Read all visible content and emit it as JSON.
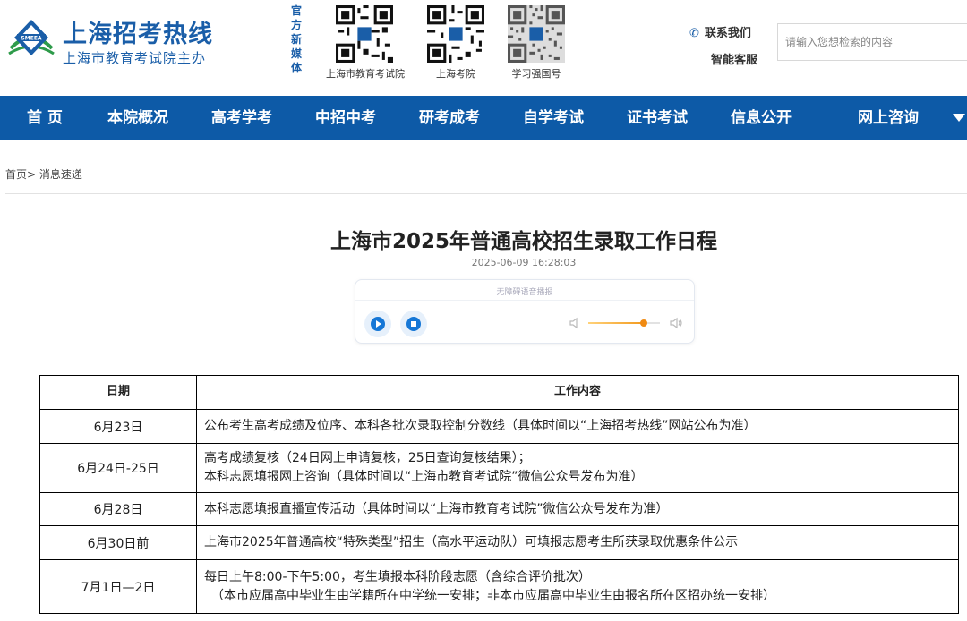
{
  "header": {
    "site_title": "上海招考热线",
    "site_subtitle": "上海市教育考试院主办",
    "logo_text": "SMEEA",
    "media_label": "官方新媒体",
    "qr_codes": [
      {
        "caption": "上海市教育考试院",
        "icon": "qr-code-icon"
      },
      {
        "caption": "上海考院",
        "icon": "qr-code-icon"
      },
      {
        "caption": "学习强国号",
        "icon": "qr-code-icon"
      }
    ],
    "contact_label": "联系我们",
    "service_label": "智能客服",
    "search_placeholder": "请输入您想检索的内容"
  },
  "nav": {
    "items": [
      {
        "label": "首 页"
      },
      {
        "label": "本院概况"
      },
      {
        "label": "高考学考"
      },
      {
        "label": "中招中考"
      },
      {
        "label": "研考成考"
      },
      {
        "label": "自学考试"
      },
      {
        "label": "证书考试"
      },
      {
        "label": "信息公开"
      },
      {
        "label": "网上咨询"
      }
    ],
    "more_icon": "triangle-down-icon"
  },
  "breadcrumb": {
    "home": "首页",
    "separator": ">",
    "current": "消息速递"
  },
  "article": {
    "title": "上海市2025年普通高校招生录取工作日程",
    "date": "2025-06-09 16:28:03"
  },
  "player": {
    "label": "无障碍语音播报",
    "volume_percent": 78
  },
  "schedule": {
    "headers": [
      "日期",
      "工作内容"
    ],
    "rows": [
      {
        "date": "6月23日",
        "lines": [
          "公布考生高考成绩及位序、本科各批次录取控制分数线（具体时间以“上海招考热线”网站公布为准）"
        ]
      },
      {
        "date": "6月24日-25日",
        "lines": [
          "高考成绩复核（24日网上申请复核，25日查询复核结果）；",
          "本科志愿填报网上咨询（具体时间以“上海市教育考试院”微信公众号发布为准）"
        ]
      },
      {
        "date": "6月28日",
        "lines": [
          "本科志愿填报直播宣传活动（具体时间以“上海市教育考试院”微信公众号发布为准）"
        ]
      },
      {
        "date": "6月30日前",
        "lines": [
          "上海市2025年普通高校“特殊类型”招生（高水平运动队）可填报志愿考生所获录取优惠条件公示"
        ]
      },
      {
        "date": "7月1日—2日",
        "lines": [
          "每日上午8:00-下午5:00，考生填报本科阶段志愿（含综合评价批次）",
          "（本市应届高中毕业生由学籍所在中学统一安排；非本市应届高中毕业生由报名所在区招办统一安排）"
        ]
      }
    ]
  },
  "colors": {
    "brand_blue": "#1a5ea8",
    "nav_blue": "#0d5aa7",
    "player_blue": "#1677d6",
    "volume_orange": "#f08a12"
  }
}
